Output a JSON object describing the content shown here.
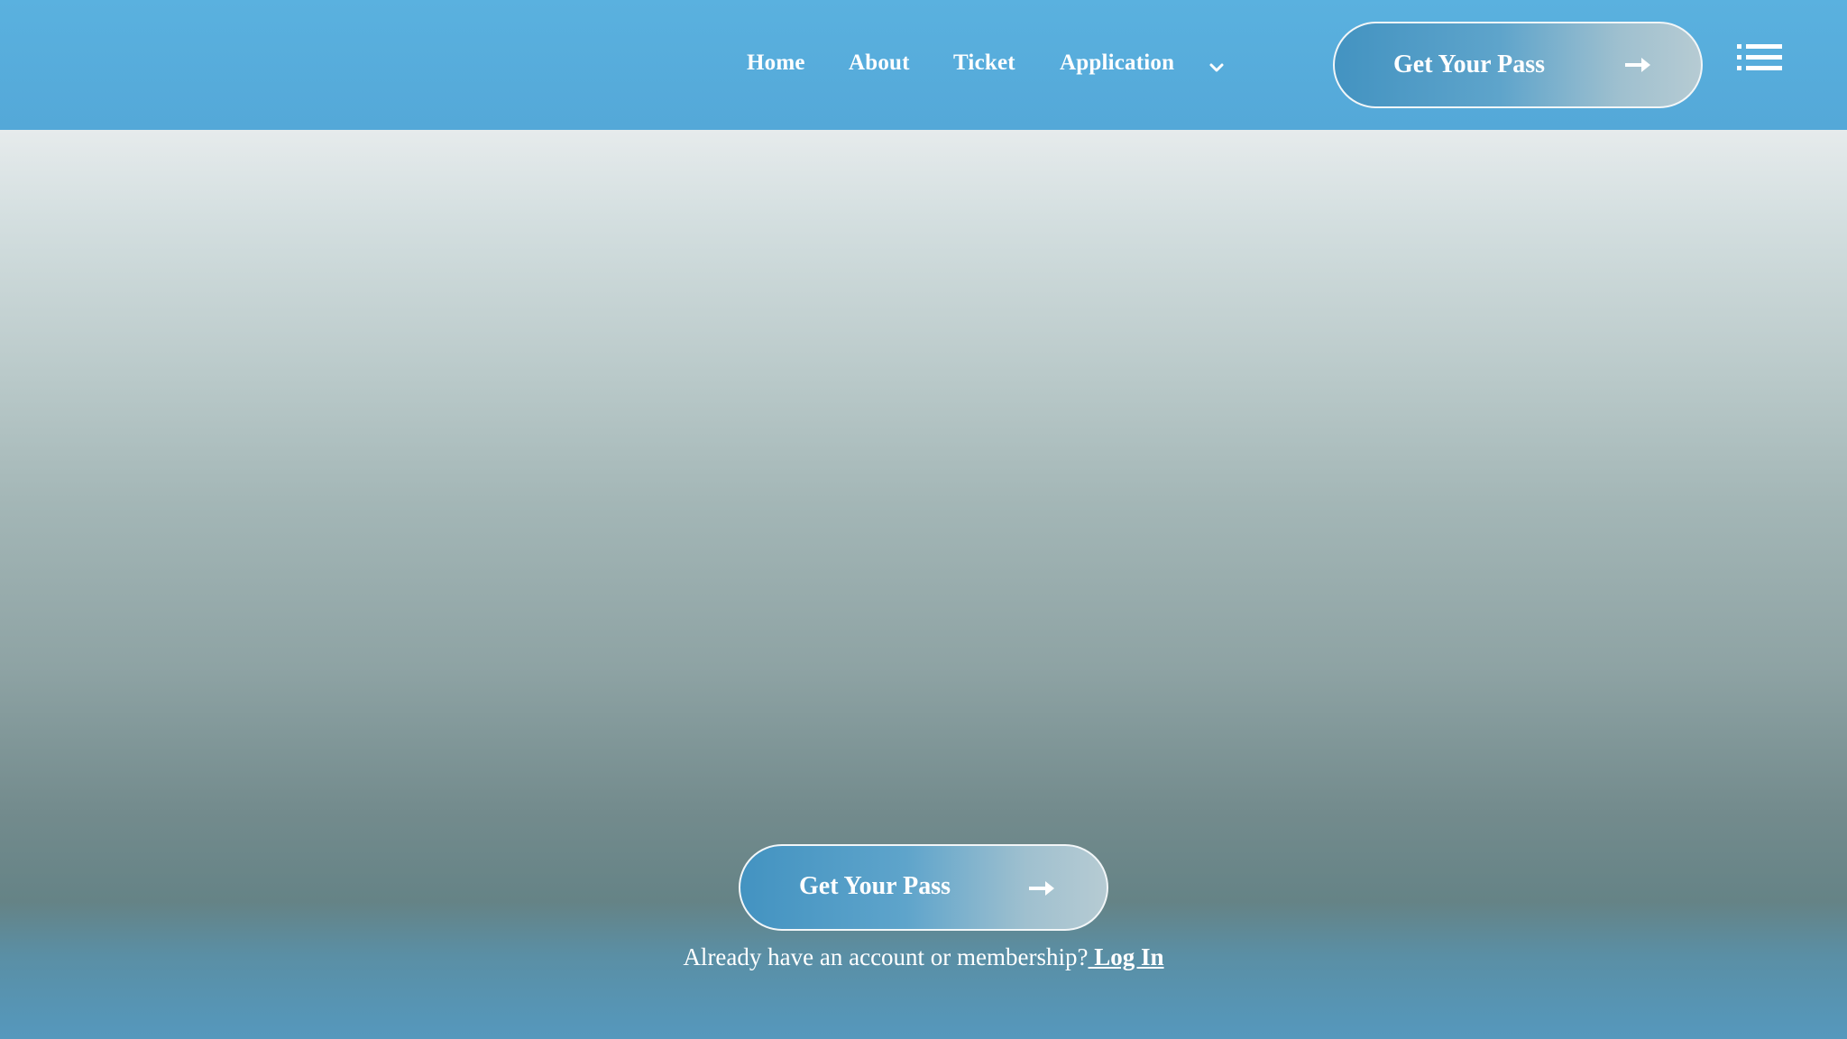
{
  "nav": {
    "items": [
      {
        "label": "Home"
      },
      {
        "label": "About"
      },
      {
        "label": "Ticket"
      },
      {
        "label": "Application"
      }
    ]
  },
  "header_cta": {
    "label": "Get Your Pass",
    "icon": "arrow-right-icon"
  },
  "menu": {
    "icon": "list-menu-icon"
  },
  "hero_cta": {
    "label": "Get Your Pass",
    "icon": "arrow-right-icon"
  },
  "footer": {
    "prompt": "Already have an account or membership?",
    "login_label": " Log In"
  },
  "colors": {
    "header": "#57acdb",
    "button_start": "#4393c1",
    "button_end": "#b6cbd3",
    "text": "#ffffff"
  }
}
